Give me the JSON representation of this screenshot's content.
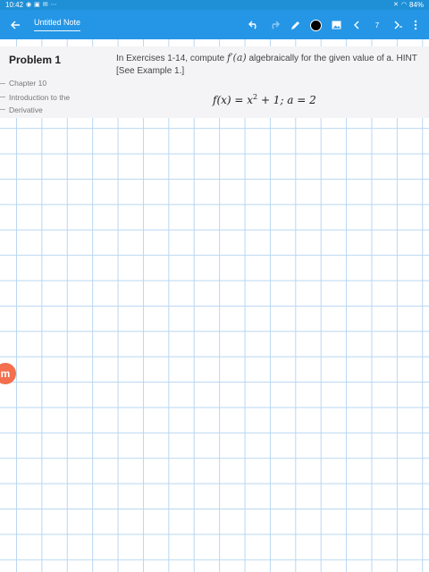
{
  "status_bar": {
    "time": "10:42",
    "battery": "84%"
  },
  "toolbar": {
    "title": "Untitled Note",
    "page_number": "7",
    "icons": [
      "back-arrow-icon",
      "undo-icon",
      "redo-icon",
      "pen-icon",
      "color-dot",
      "image-icon",
      "prev-page-icon",
      "page-number",
      "next-page-icon",
      "more-vert-icon"
    ],
    "pen_color": "#000000",
    "accent": "#2596e6"
  },
  "problem": {
    "label": "Problem 1",
    "chapter": "Chapter 10",
    "chapter_title": "Introduction to the Derivative",
    "instructions_pre": "In Exercises 1-14, compute",
    "instructions_math": "f′(a)",
    "instructions_post": "algebraically for the given value of a. HINT [See Example 1.]",
    "formula_lhs": "f(x) = x",
    "formula_exp": "2",
    "formula_rhs": " + 1; a = 2"
  },
  "logo": {
    "glyph": "m"
  }
}
